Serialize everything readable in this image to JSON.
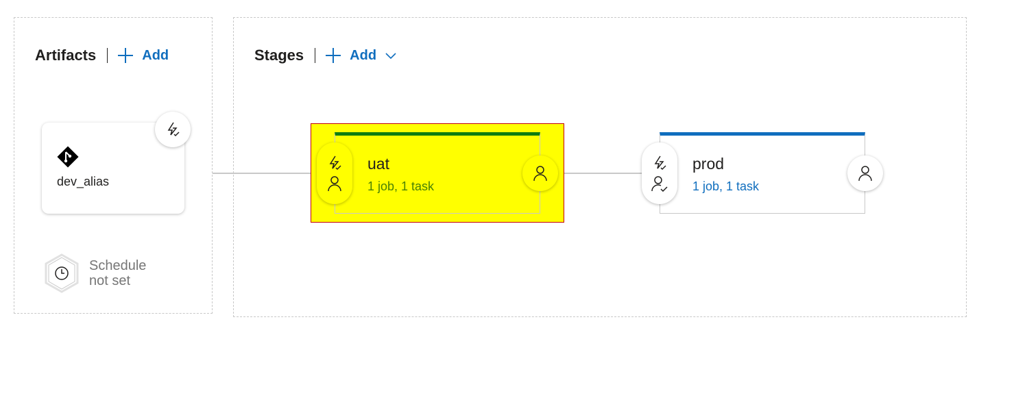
{
  "artifacts": {
    "title": "Artifacts",
    "add_label": "Add",
    "items": [
      {
        "name": "dev_alias",
        "icon": "git-icon"
      }
    ],
    "schedule": {
      "line1": "Schedule",
      "line2": "not set",
      "icon": "clock-icon"
    }
  },
  "stages": {
    "title": "Stages",
    "add_label": "Add",
    "items": [
      {
        "name": "uat",
        "summary": "1 job, 1 task",
        "status_color": "#107c10",
        "highlight": "#ffff00"
      },
      {
        "name": "prod",
        "summary": "1 job, 1 task",
        "status_color": "#106ebe"
      }
    ]
  },
  "colors": {
    "accent": "#106ebe",
    "uat_status": "#107c10",
    "prod_status": "#106ebe",
    "highlight": "#ffff00",
    "highlight_border": "#c00000"
  }
}
